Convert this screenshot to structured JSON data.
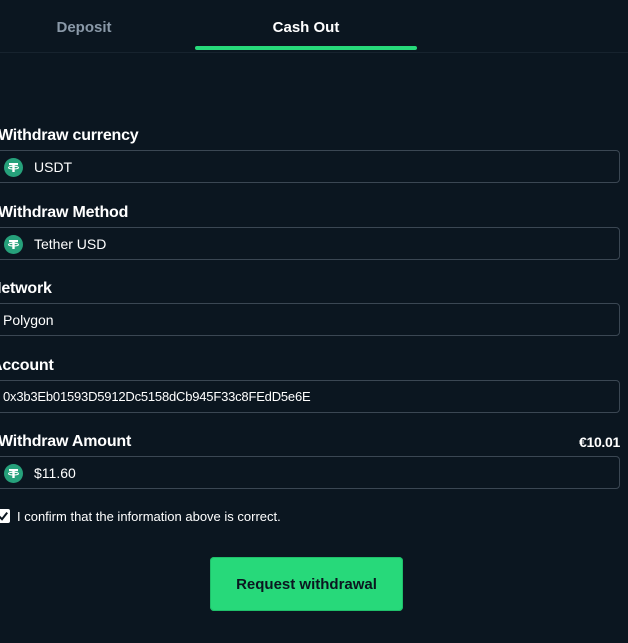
{
  "tabs": {
    "deposit": "Deposit",
    "cash_out": "Cash Out"
  },
  "form": {
    "currency": {
      "label": "Withdraw currency",
      "value": "USDT",
      "icon": "tether-icon"
    },
    "method": {
      "label": "Withdraw Method",
      "value": "Tether USD",
      "icon": "tether-icon"
    },
    "network": {
      "label": "Network",
      "value": "Polygon"
    },
    "account": {
      "label": "Account",
      "value": "0x3b3Eb01593D5912Dc5158dCb945F33c8FEdD5e6E"
    },
    "amount": {
      "label": "Withdraw Amount",
      "value": "$11.60",
      "converted": "€10.01",
      "icon": "tether-icon"
    },
    "confirm": {
      "text": "I confirm that the information above is correct.",
      "checked": true
    },
    "submit_label": "Request withdrawal"
  },
  "colors": {
    "background": "#0b1620",
    "accent": "#27d97a",
    "tab_inactive": "#8a99a8",
    "border": "#3b4753",
    "tether": "#26a17b"
  }
}
